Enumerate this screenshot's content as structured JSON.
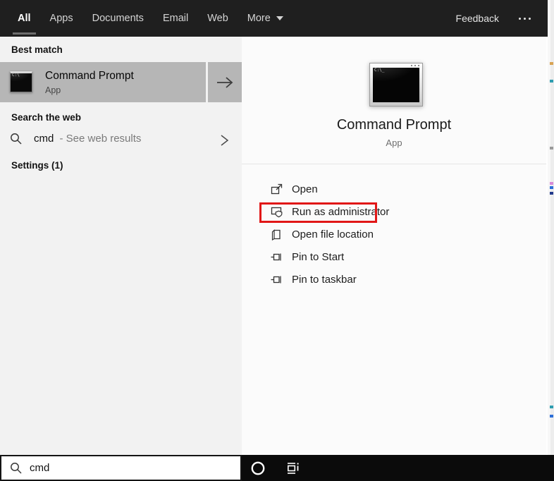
{
  "header": {
    "tabs": [
      "All",
      "Apps",
      "Documents",
      "Email",
      "Web",
      "More"
    ],
    "selected_tab": "All",
    "feedback_label": "Feedback"
  },
  "left_panel": {
    "best_match_section": "Best match",
    "best_match": {
      "title": "Command Prompt",
      "subtitle": "App"
    },
    "web_section": "Search the web",
    "web_result": {
      "query": "cmd",
      "hint": "- See web results"
    },
    "settings_section": "Settings (1)"
  },
  "right_panel": {
    "app_name": "Command Prompt",
    "app_type": "App",
    "actions": [
      {
        "label": "Open",
        "icon": "open-window-icon"
      },
      {
        "label": "Run as administrator",
        "icon": "run-as-admin-shield-icon",
        "highlighted": true
      },
      {
        "label": "Open file location",
        "icon": "open-file-location-icon"
      },
      {
        "label": "Pin to Start",
        "icon": "pin-icon"
      },
      {
        "label": "Pin to taskbar",
        "icon": "pin-icon"
      }
    ]
  },
  "taskbar": {
    "search_value": "cmd"
  },
  "colors": {
    "header_bg": "#1f1f1f",
    "left_panel_bg": "#f2f2f2",
    "right_panel_bg": "#fbfbfb",
    "best_match_highlight": "#b6b6b6",
    "taskbar_bg": "#0b0b0b",
    "annotation_red": "#e11717"
  }
}
